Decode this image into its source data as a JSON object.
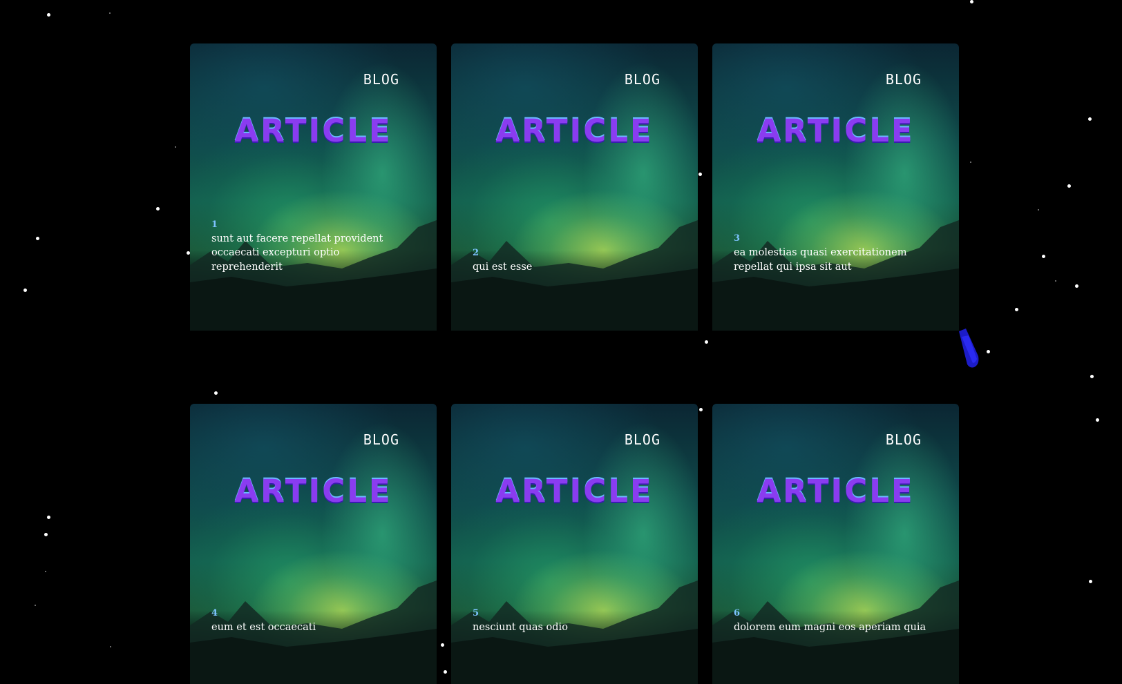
{
  "cards": [
    {
      "label": "BLOG",
      "title": "ARTICLE",
      "id": "1",
      "text": "sunt aut facere repellat provident occaecati excepturi optio reprehenderit"
    },
    {
      "label": "BLOG",
      "title": "ARTICLE",
      "id": "2",
      "text": "qui est esse"
    },
    {
      "label": "BLOG",
      "title": "ARTICLE",
      "id": "3",
      "text": "ea molestias quasi exercitationem repellat qui ipsa sit aut"
    },
    {
      "label": "BLOG",
      "title": "ARTICLE",
      "id": "4",
      "text": "eum et est occaecati"
    },
    {
      "label": "BLOG",
      "title": "ARTICLE",
      "id": "5",
      "text": "nesciunt quas odio"
    },
    {
      "label": "BLOG",
      "title": "ARTICLE",
      "id": "6",
      "text": "dolorem eum magni eos aperiam quia"
    }
  ],
  "theme": {
    "background": "#000000",
    "title_color": "#8a3cf0",
    "id_color": "#7ec3ff",
    "text_color": "#ffffff"
  }
}
